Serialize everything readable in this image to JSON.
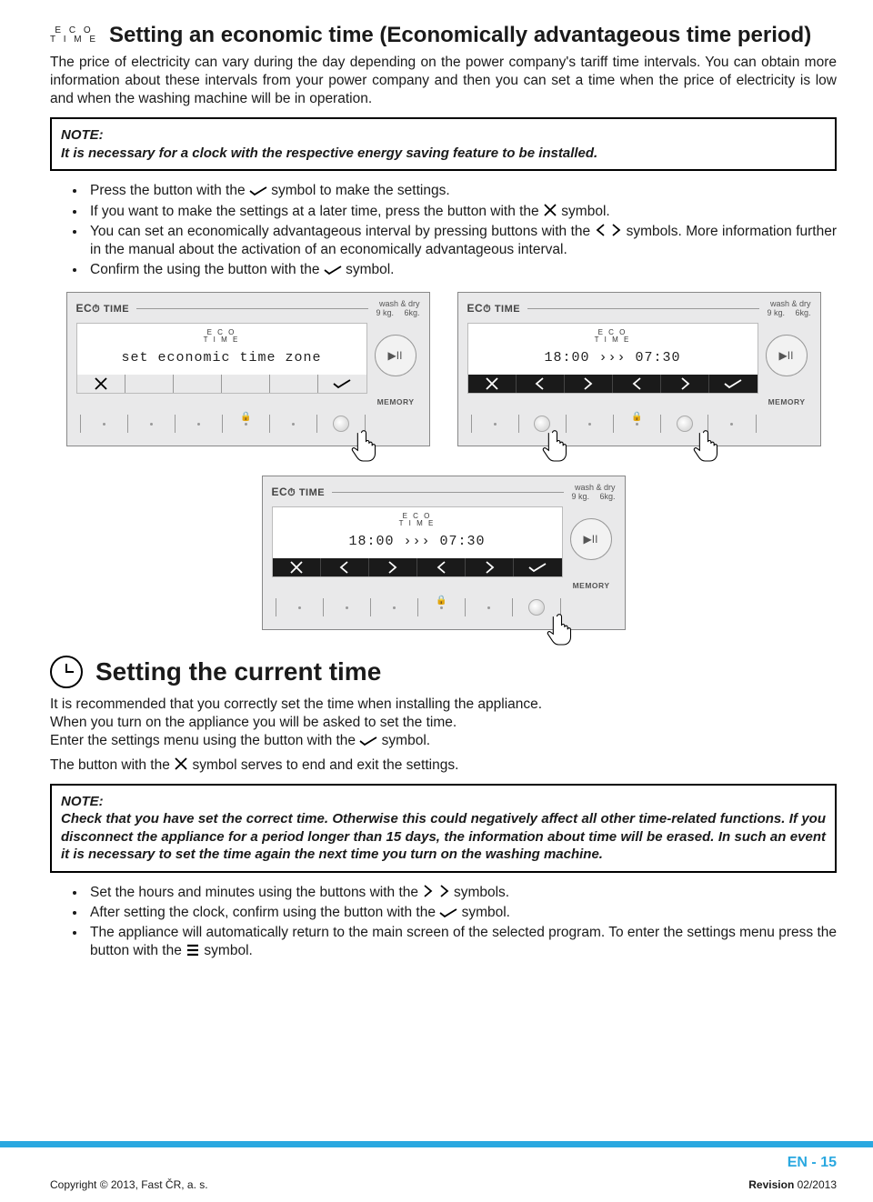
{
  "section1": {
    "eco_line1": "E C O",
    "eco_line2": "T I M E",
    "title": "Setting an economic time (Economically advantageous time period)",
    "intro": "The price of electricity can vary during the day depending on the power company's tariff time intervals. You can obtain more information about these intervals from your power company and then you can set a time when the price of electricity is low and when the washing machine will be in operation.",
    "note_label": "NOTE:",
    "note_text": "It is necessary for a clock with the respective energy saving feature to be installed.",
    "b1a": "Press the button with the ",
    "b1b": " symbol to make the settings.",
    "b2a": "If you want to make the settings at a later time, press the button with the ",
    "b2b": " symbol.",
    "b3a": "You can set an economically advantageous interval by pressing buttons with the ",
    "b3b": " symbols. More information further in the manual about the activation of an economically advantageous interval.",
    "b4a": "Confirm the using the button with the ",
    "b4b": " symbol."
  },
  "panel": {
    "brand_eco": "EC",
    "brand_time": " TIME",
    "wash_dry": "wash & dry",
    "weights": "9 kg.  6kg.",
    "eco_small1": "E C O",
    "eco_small2": "T I M E",
    "lcd1": "set economic time zone",
    "lcd2": "18:00  ›››  07:30",
    "lcd3": "18:00  ›››  07:30",
    "memory": "MEMORY",
    "play": "▶II"
  },
  "section2": {
    "title": "Setting the current time",
    "p1": "It is recommended that you correctly set the time when installing the appliance.",
    "p2": "When you turn on the appliance you will be asked to set the time.",
    "p3a": "Enter the settings menu using the button with the ",
    "p3b": " symbol.",
    "p4a": "The button with the ",
    "p4b": " symbol serves to end and exit the settings.",
    "note_label": "NOTE:",
    "note_text": "Check that you have set the correct time. Otherwise this could negatively affect all other time-related functions. If you disconnect the appliance for a period longer than 15 days, the information about time will be erased. In such an event it is necessary to set the time again the next time you turn on the washing machine.",
    "b1a": "Set the hours and minutes using the buttons with the ",
    "b1b": " symbols.",
    "b2a": "After setting the clock, confirm using the button with the ",
    "b2b": " symbol.",
    "b3a": "The appliance will automatically return to the main screen of the selected program. To enter the settings menu press the button with the ",
    "b3b": " symbol."
  },
  "footer": {
    "page": "EN - 15",
    "copyright": "Copyright © 2013, Fast ČR, a. s.",
    "rev_label": "Revision",
    "rev_val": " 02/2013"
  }
}
